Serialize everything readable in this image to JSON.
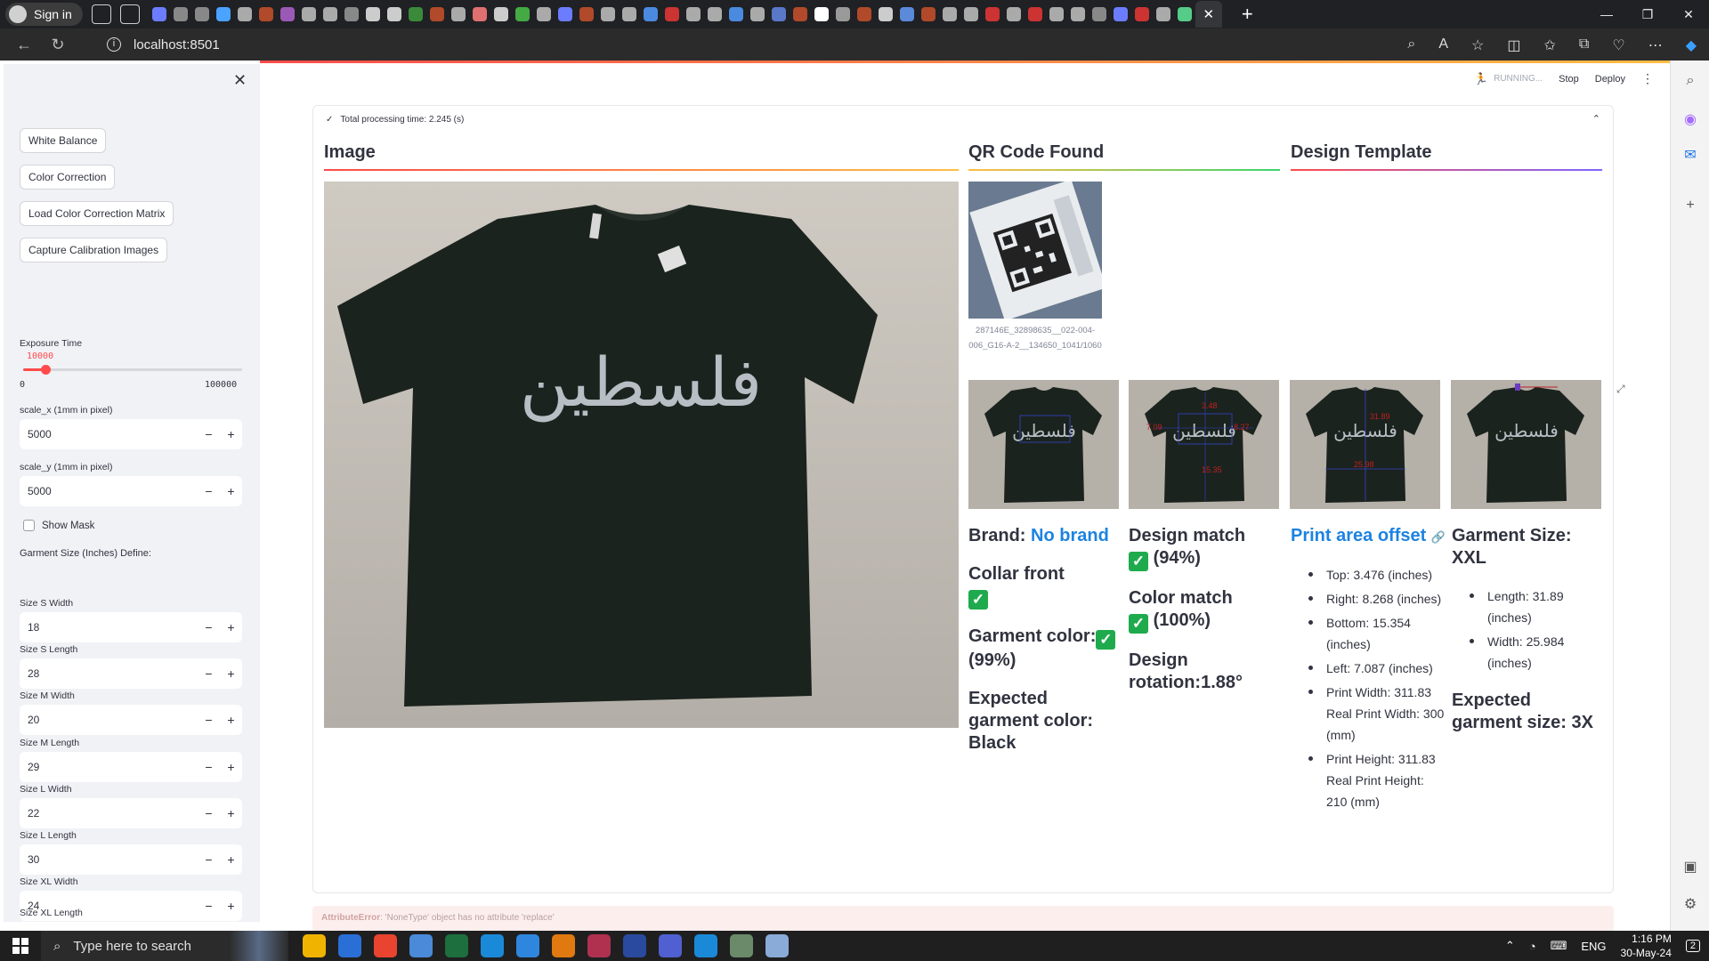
{
  "browser": {
    "signin": "Sign in",
    "url": "localhost:8501",
    "new_tab": "+"
  },
  "sidebar": {
    "buttons": [
      "White Balance",
      "Color Correction",
      "Load Color Correction Matrix",
      "Capture Calibration Images"
    ],
    "exposure": {
      "label": "Exposure Time",
      "value": "10000",
      "min": "0",
      "max": "100000",
      "fraction": 0.1
    },
    "scale_x": {
      "label": "scale_x (1mm in pixel)",
      "value": "5000"
    },
    "scale_y": {
      "label": "scale_y (1mm in pixel)",
      "value": "5000"
    },
    "show_mask": "Show Mask",
    "garment_header": "Garment Size (Inches) Define:",
    "sizes": [
      {
        "label": "Size S Width",
        "value": "18"
      },
      {
        "label": "Size S Length",
        "value": "28"
      },
      {
        "label": "Size M Width",
        "value": "20"
      },
      {
        "label": "Size M Length",
        "value": "29"
      },
      {
        "label": "Size L Width",
        "value": "22"
      },
      {
        "label": "Size L Length",
        "value": "30"
      },
      {
        "label": "Size XL Width",
        "value": "24"
      }
    ],
    "last_label": "Size XL Length"
  },
  "status": {
    "running": "RUNNING...",
    "stop": "Stop",
    "deploy": "Deploy"
  },
  "expander": {
    "title": "Total processing time: 2.245 (s)"
  },
  "headers": {
    "image": "Image",
    "qr": "QR Code Found",
    "template": "Design Template"
  },
  "qr_caption": "287146E_32898635__022-004-006_G16-A-2__134650_1041/1060",
  "tshirt_text": "فلسطين",
  "overlay_labels": {
    "t2": [
      "3.48",
      "7.09",
      "8.27",
      "15.35"
    ],
    "t3": [
      "31.89",
      "25.98"
    ]
  },
  "col1": {
    "brand_label": "Brand:",
    "brand_value": "No brand",
    "collar": "Collar front",
    "garment_color": "Garment color:",
    "garment_pct": "(99%)",
    "expected": "Expected garment color: Black"
  },
  "col2": {
    "design_match": "Design match",
    "design_pct": "(94%)",
    "color_match": "Color match",
    "color_pct": "(100%)",
    "rotation": "Design rotation:1.88°"
  },
  "col3": {
    "title": "Print area offset",
    "items": [
      "Top: 3.476 (inches)",
      "Right: 8.268 (inches)",
      "Bottom: 15.354 (inches)",
      "Left: 7.087 (inches)",
      "Print Width: 311.83 Real Print Width: 300 (mm)",
      "Print Height: 311.83 Real Print Height: 210 (mm)"
    ]
  },
  "col4": {
    "title": "Garment Size: XXL",
    "items": [
      "Length: 31.89 (inches)",
      "Width: 25.984 (inches)"
    ],
    "expected": "Expected garment size: 3X"
  },
  "error": {
    "type": "AttributeError",
    "message": ": 'NoneType' object has no attribute 'replace'"
  },
  "taskbar": {
    "search": "Type here to search",
    "lang": "ENG",
    "time": "1:16 PM",
    "date": "30-May-24",
    "notif": "2"
  },
  "colors": {
    "accent": "#ff4b4b",
    "success": "#1fab4d",
    "link": "#1c83e1"
  }
}
